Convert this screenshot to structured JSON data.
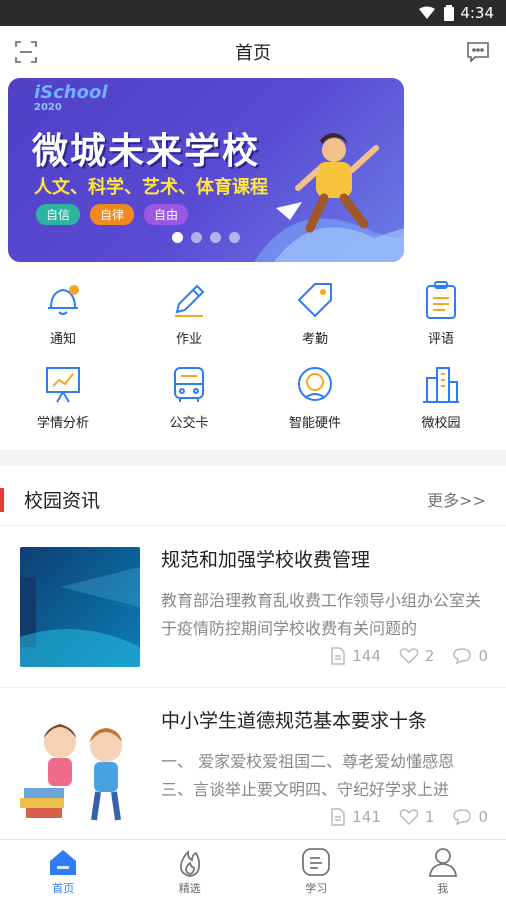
{
  "status_bar": {
    "time": "4:34"
  },
  "top_bar": {
    "title": "首页"
  },
  "banner": {
    "brand": "iSchool",
    "year": "2020",
    "headline": "微城未来学校",
    "subtitle": "人文、科学、艺术、体育课程",
    "tags": [
      {
        "label": "自信",
        "color": "#2bb5a0"
      },
      {
        "label": "自律",
        "color": "#ef8a1f"
      },
      {
        "label": "自由",
        "color": "#9b59e3"
      }
    ],
    "active_slide": 1,
    "slide_count": 4
  },
  "quick_grid": [
    {
      "label": "通知",
      "icon": "bell-icon"
    },
    {
      "label": "作业",
      "icon": "pencil-icon"
    },
    {
      "label": "考勤",
      "icon": "tag-icon"
    },
    {
      "label": "评语",
      "icon": "clipboard-icon"
    },
    {
      "label": "学情分析",
      "icon": "chart-board-icon"
    },
    {
      "label": "公交卡",
      "icon": "bus-icon"
    },
    {
      "label": "智能硬件",
      "icon": "smart-device-icon"
    },
    {
      "label": "微校园",
      "icon": "building-icon"
    }
  ],
  "news_section": {
    "title": "校园资讯",
    "more": "更多>>",
    "items": [
      {
        "title": "规范和加强学校收费管理",
        "desc": "教育部治理教育乱收费工作领导小组办公室关于疫情防控期间学校收费有关问题的",
        "views": "144",
        "likes": "2",
        "comments": "0"
      },
      {
        "title": "中小学生道德规范基本要求十条",
        "desc": "一、 爱家爱校爱祖国二、尊老爱幼懂感恩三、言谈举止要文明四、守纪好学求上进",
        "views": "141",
        "likes": "1",
        "comments": "0"
      }
    ]
  },
  "tab_bar": {
    "tabs": [
      {
        "label": "首页",
        "active": true
      },
      {
        "label": "精选",
        "active": false
      },
      {
        "label": "学习",
        "active": false
      },
      {
        "label": "我",
        "active": false
      }
    ]
  },
  "colors": {
    "accent": "#2f7cf6",
    "section_bar": "#e53935"
  }
}
